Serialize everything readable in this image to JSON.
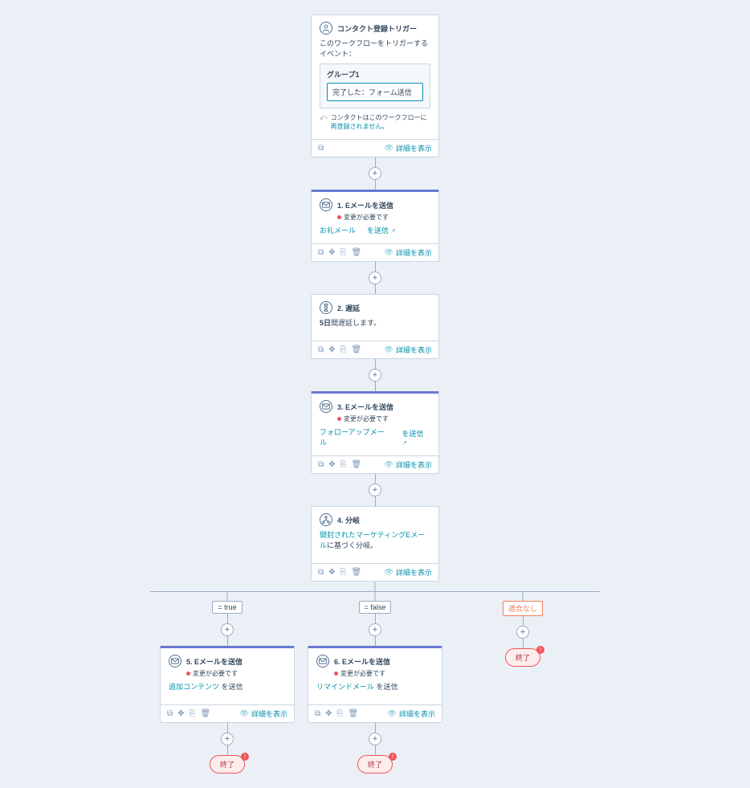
{
  "trigger": {
    "header": "コンタクト登録トリガー",
    "prompt": "このワークフローをトリガーするイベント：",
    "group_title": "グループ1",
    "group_item": "完了した：フォーム送信",
    "note_prefix": "コンタクトはこのワークフローに",
    "note_link": "再登録されません",
    "note_suffix": "。",
    "details": "詳細を表示"
  },
  "step1": {
    "title": "1. Eメールを送信",
    "warn": "変更が必要です",
    "link1": "お礼メール",
    "link2": "を送信",
    "details": "詳細を表示"
  },
  "step2": {
    "title": "2. 遅延",
    "body_bold": "5日",
    "body_rest": "間遅延します。",
    "details": "詳細を表示"
  },
  "step3": {
    "title": "3. Eメールを送信",
    "warn": "変更が必要です",
    "link1": "フォローアップメール",
    "link2": "を送信",
    "details": "詳細を表示"
  },
  "step4": {
    "title": "4. 分岐",
    "link": "開封されたマーケティングEメール",
    "rest": "に基づく分岐。",
    "details": "詳細を表示"
  },
  "branches": {
    "true": {
      "tag": "= true",
      "card": {
        "title": "5. Eメールを送信",
        "warn": "変更が必要です",
        "link": "追加コンテンツ",
        "rest": " を送信",
        "details": "詳細を表示"
      },
      "end": "終了"
    },
    "false": {
      "tag": "= false",
      "card": {
        "title": "6. Eメールを送信",
        "warn": "変更が必要です",
        "link": "リマインドメール",
        "rest": " を送信",
        "details": "詳細を表示"
      },
      "end": "終了"
    },
    "nomatch": {
      "tag": "適合なし",
      "end": "終了"
    }
  }
}
